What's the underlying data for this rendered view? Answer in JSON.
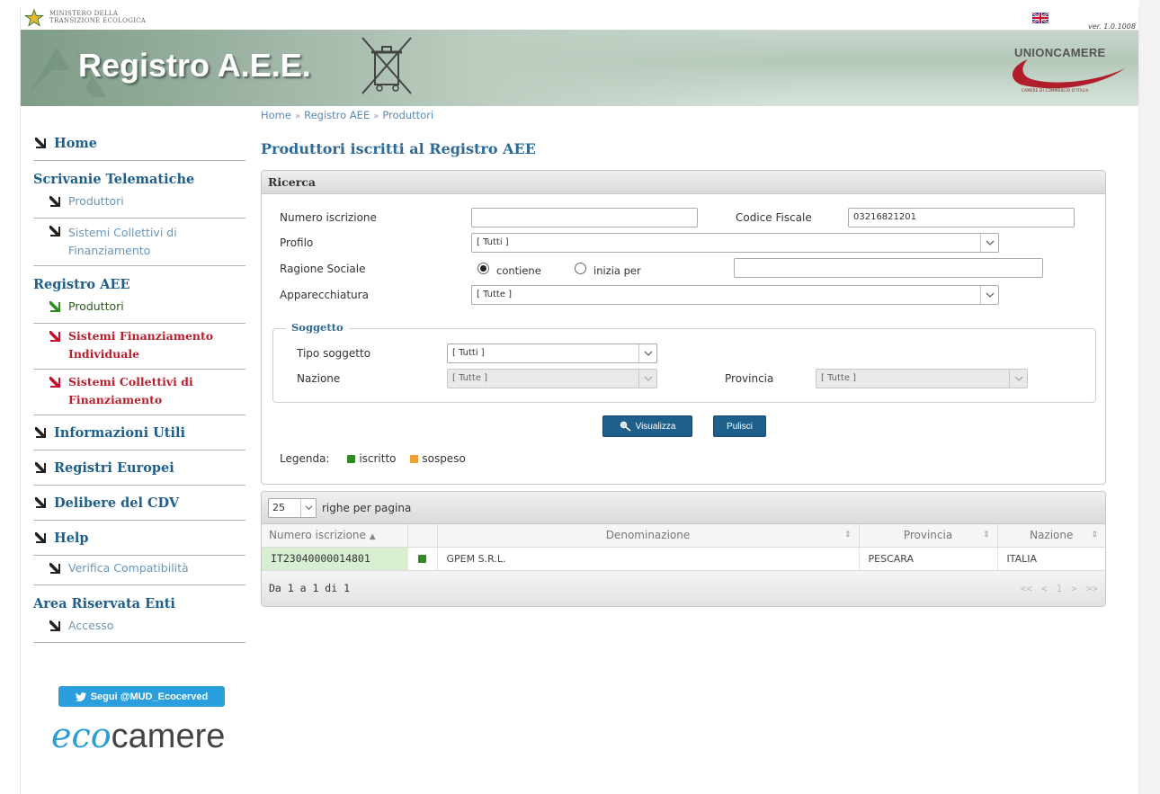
{
  "header": {
    "ministry_line1": "MINISTERO DELLA",
    "ministry_line2": "TRANSIZIONE ECOLOGICA",
    "title": "Registro A.E.E.",
    "version": "ver. 1.0.1008",
    "partner": "UNIONCAMERE",
    "partner_sub": "CAMERE DI COMMERCIO D'ITALIA",
    "language_flag_icon": "uk-flag-icon"
  },
  "breadcrumb": [
    "Home",
    "Registro AEE",
    "Produttori"
  ],
  "page_title": "Produttori iscritti al Registro AEE",
  "sidebar": {
    "home": "Home",
    "scrivanie": {
      "title": "Scrivanie Telematiche",
      "items": [
        "Produttori",
        "Sistemi Collettivi di Finanziamento"
      ]
    },
    "registro": {
      "title": "Registro AEE",
      "items": [
        "Produttori",
        "Sistemi Finanziamento Individuale",
        "Sistemi Collettivi di Finanziamento"
      ]
    },
    "main_links": [
      "Informazioni Utili",
      "Registri Europei",
      "Delibere del CDV",
      "Help"
    ],
    "help_sub": "Verifica Compatibilità",
    "area": {
      "title": "Area Riservata Enti",
      "items": [
        "Accesso"
      ]
    },
    "twitter": "Segui @MUD_Ecocerved",
    "ecocamere_eco": "eco",
    "ecocamere_rest": "camere"
  },
  "search": {
    "panel_title": "Ricerca",
    "numero_label": "Numero iscrizione",
    "numero_value": "",
    "cf_label": "Codice Fiscale",
    "cf_value": "03216821201",
    "profilo_label": "Profilo",
    "profilo_value": "[ Tutti ]",
    "ragione_label": "Ragione Sociale",
    "ragione_opt1": "contiene",
    "ragione_opt2": "inizia per",
    "ragione_value": "",
    "apparecchiatura_label": "Apparecchiatura",
    "apparecchiatura_value": "[ Tutte ]",
    "soggetto": {
      "title": "Soggetto",
      "tipo_label": "Tipo soggetto",
      "tipo_value": "[ Tutti ]",
      "nazione_label": "Nazione",
      "nazione_value": "[ Tutte ]",
      "provincia_label": "Provincia",
      "provincia_value": "[ Tutte ]"
    },
    "btn_visualizza": "Visualizza",
    "btn_pulisci": "Pulisci",
    "legenda_label": "Legenda:",
    "legenda_iscritto": "iscritto",
    "legenda_sospeso": "sospeso",
    "color_iscritto": "#2e8b1f",
    "color_sospeso": "#f0a030"
  },
  "results": {
    "rows_per_page": "25",
    "rows_per_page_label": "righe per pagina",
    "columns": [
      "Numero iscrizione",
      "Denominazione",
      "Provincia",
      "Nazione"
    ],
    "rows": [
      {
        "numero": "IT23040000014801",
        "denominazione": "GPEM S.R.L.",
        "provincia": "PESCARA",
        "nazione": "ITALIA"
      }
    ],
    "summary": "Da 1 a 1 di 1",
    "pager": [
      "<<",
      "<",
      "1",
      ">",
      ">>"
    ]
  }
}
